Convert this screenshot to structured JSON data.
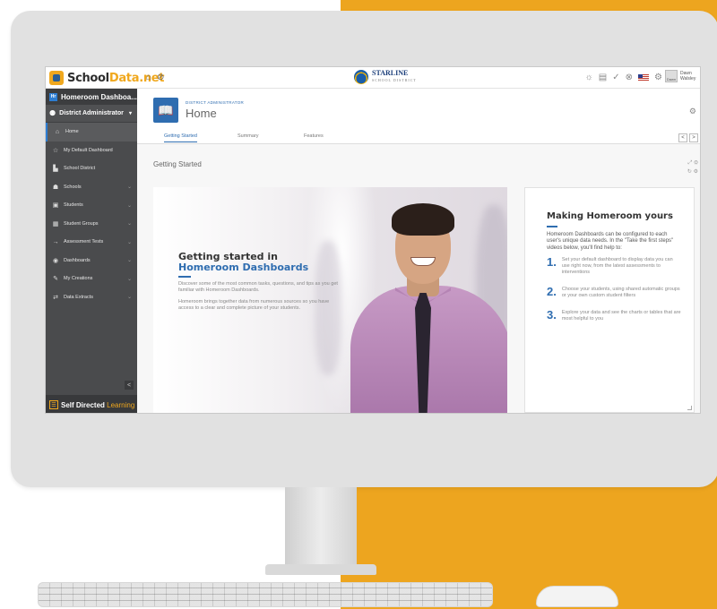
{
  "topbar": {
    "logo_part1": "School",
    "logo_part2": "Data.net",
    "district_name": "STARLINE",
    "district_sub": "SCHOOL DISTRICT",
    "user_name": "Dawn Walsley",
    "avatar_text": "Dawn"
  },
  "sidebar": {
    "badge": "Hr",
    "title": "Homeroom Dashboa...",
    "role": "District Administrator",
    "collapse_icon": "<",
    "items": [
      {
        "label": "Home",
        "icon": "home-icon"
      },
      {
        "label": "My Default Dashboard",
        "icon": "star-icon"
      },
      {
        "label": "School District",
        "icon": "building-icon"
      },
      {
        "label": "Schools",
        "icon": "sitemap-icon"
      },
      {
        "label": "Students",
        "icon": "student-icon"
      },
      {
        "label": "Student Groups",
        "icon": "group-icon"
      },
      {
        "label": "Assessment Tests",
        "icon": "arrow-icon"
      },
      {
        "label": "Dashboards",
        "icon": "dashboard-icon"
      },
      {
        "label": "My Creations",
        "icon": "creations-icon"
      },
      {
        "label": "Data Extracts",
        "icon": "extract-icon"
      }
    ],
    "footer_part1": "Self Directed ",
    "footer_part2": "Learning"
  },
  "header": {
    "role_label": "DISTRICT ADMINISTRATOR",
    "title": "Home"
  },
  "tabs": [
    {
      "label": "Getting Started"
    },
    {
      "label": "Summary"
    },
    {
      "label": "Features"
    }
  ],
  "section": {
    "title": "Getting Started"
  },
  "hero": {
    "title_part1": "Getting started in ",
    "title_part2": "Homeroom Dashboards",
    "p1": "Discover some of the most common tasks, questions, and tips as you get familiar with Homeroom Dashboards.",
    "p2": "Homeroom brings together data from numerous sources so you have access to a clear and complete picture of your students."
  },
  "card": {
    "title": "Making Homeroom yours",
    "intro": "Homeroom Dashboards can be configured to each user's unique data needs. In the \"Take the first steps\" videos below, you'll find help to:",
    "steps": [
      {
        "num": "1.",
        "text": "Set your default dashboard to display data you can use right now, from the latest assessments to interventions"
      },
      {
        "num": "2.",
        "text": "Choose your students, using shared automatic groups or your own custom student filters"
      },
      {
        "num": "3.",
        "text": "Explore your data and see the charts or tables that are most helpful to you"
      }
    ]
  },
  "colors": {
    "accent_blue": "#2f6db0",
    "brand_orange": "#f0a81e",
    "sidebar_bg": "#4a4b4d",
    "backdrop_orange": "#eda51f"
  }
}
